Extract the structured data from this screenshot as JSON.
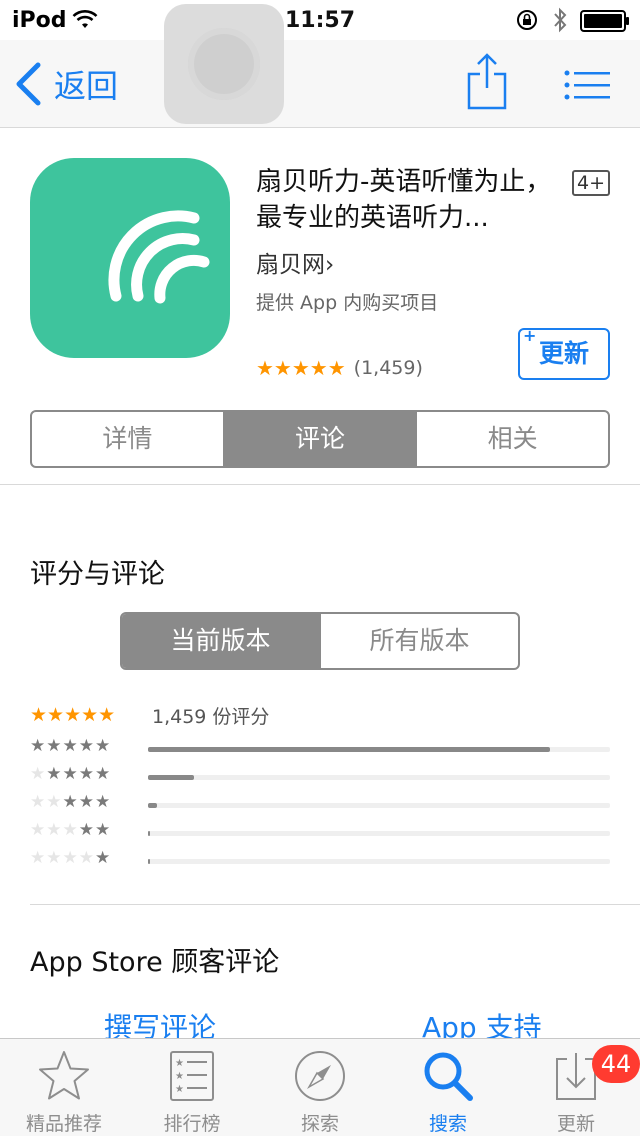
{
  "status_bar": {
    "carrier": "iPod",
    "time": "11:57"
  },
  "nav": {
    "back_label": "返回"
  },
  "app": {
    "title": "扇贝听力-英语听懂为止，最专业的英语听力...",
    "age_rating": "4+",
    "developer": "扇贝网",
    "developer_chevron": "›",
    "iap_note": "提供 App 内购买项目",
    "rating_stars": "★★★★★",
    "rating_count": "(1,459)",
    "update_plus": "+",
    "update_label": "更新",
    "icon_color": "#3ec49d"
  },
  "segments": {
    "main": [
      {
        "label": "详情",
        "active": false
      },
      {
        "label": "评论",
        "active": true
      },
      {
        "label": "相关",
        "active": false
      }
    ]
  },
  "ratings": {
    "section_title": "评分与评论",
    "versions": [
      {
        "label": "当前版本",
        "active": true
      },
      {
        "label": "所有版本",
        "active": false
      }
    ],
    "summary_stars": "★★★★★",
    "summary_count": "1,459 份评分",
    "histogram": [
      {
        "stars": 5,
        "fraction": 0.87
      },
      {
        "stars": 4,
        "fraction": 0.1
      },
      {
        "stars": 3,
        "fraction": 0.02
      },
      {
        "stars": 2,
        "fraction": 0.005
      },
      {
        "stars": 1,
        "fraction": 0.005
      }
    ]
  },
  "reviews": {
    "section_title": "App Store 顾客评论",
    "write_review": "撰写评论",
    "app_support": "App 支持"
  },
  "tab_bar": {
    "tabs": [
      {
        "label": "精品推荐",
        "icon": "star-icon",
        "active": false
      },
      {
        "label": "排行榜",
        "icon": "list-icon",
        "active": false
      },
      {
        "label": "探索",
        "icon": "compass-icon",
        "active": false
      },
      {
        "label": "搜索",
        "icon": "search-icon",
        "active": true
      },
      {
        "label": "更新",
        "icon": "download-icon",
        "active": false
      }
    ],
    "updates_badge": "44"
  },
  "colors": {
    "accent": "#1a7ff0",
    "star": "#ff9500",
    "badge": "#ff3b30"
  }
}
